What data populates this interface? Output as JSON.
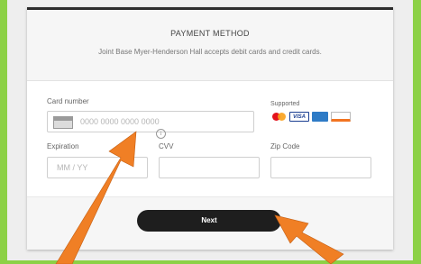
{
  "header": {
    "title": "PAYMENT METHOD",
    "subtitle": "Joint Base Myer-Henderson Hall accepts debit cards and credit cards."
  },
  "card_number": {
    "label": "Card number",
    "placeholder": "0000 0000 0000 0000",
    "icon": "credit-card-icon"
  },
  "supported": {
    "label": "Supported",
    "brands": [
      {
        "name": "mastercard",
        "text": ""
      },
      {
        "name": "visa",
        "text": "VISA"
      },
      {
        "name": "amex",
        "text": "AMERICAN EXPRESS"
      },
      {
        "name": "discover",
        "text": "DISCOVER"
      }
    ]
  },
  "expiration": {
    "label": "Expiration",
    "placeholder": "MM / YY"
  },
  "cvv": {
    "label": "CVV",
    "info_icon": "info-icon",
    "info_glyph": "i",
    "placeholder": ""
  },
  "zip": {
    "label": "Zip Code",
    "placeholder": ""
  },
  "actions": {
    "next_label": "Next"
  },
  "colors": {
    "background": "#8cd146",
    "arrow": "#f07f25",
    "button": "#1e1e1e"
  }
}
